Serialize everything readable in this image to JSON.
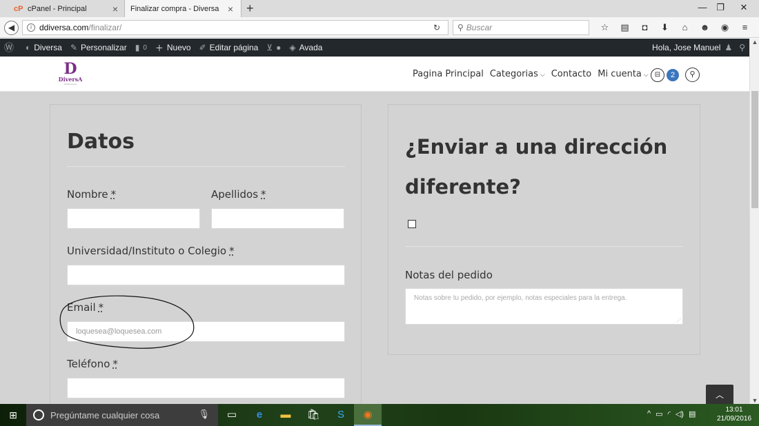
{
  "browser": {
    "tabs": [
      {
        "label": "cPanel - Principal",
        "active": false
      },
      {
        "label": "Finalizar compra - Diversa",
        "active": true
      }
    ],
    "url_host": "ddiversa.com",
    "url_path": "/finalizar/",
    "search_placeholder": "Buscar"
  },
  "wpbar": {
    "site": "Diversa",
    "customize": "Personalizar",
    "comments": "0",
    "new": "Nuevo",
    "edit": "Editar página",
    "theme": "Avada",
    "greeting": "Hola, Jose Manuel"
  },
  "site": {
    "logo_letter": "D",
    "logo_word": "DiversA",
    "logo_sub": "Distribuciones",
    "nav": {
      "home": "Pagina Principal",
      "categories": "Categorias",
      "contact": "Contacto",
      "account": "Mi cuenta",
      "cart_count": "2"
    }
  },
  "form": {
    "title": "Datos",
    "required_mark": "*",
    "first_name_label": "Nombre",
    "last_name_label": "Apellidos",
    "school_label": "Universidad/Instituto o Colegio",
    "email_label": "Email",
    "email_placeholder": "loquesea@loquesea.com",
    "phone_label": "Teléfono"
  },
  "shipping": {
    "title_line1": "¿Enviar a una dirección",
    "title_line2": "diferente?",
    "notes_label": "Notas del pedido",
    "notes_placeholder": "Notas sobre tu pedido, por ejemplo, notas especiales para la entrega."
  },
  "taskbar": {
    "search": "Pregúntame cualquier cosa",
    "time": "13:01",
    "date": "21/09/2016"
  }
}
